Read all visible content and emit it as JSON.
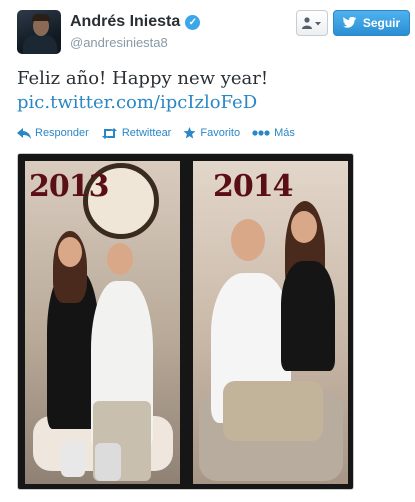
{
  "user": {
    "display_name": "Andrés Iniesta",
    "screen_name": "@andresiniesta8",
    "verified": true
  },
  "buttons": {
    "follow_label": "Seguir",
    "follow_menu_icon": "user-dropdown-icon"
  },
  "tweet": {
    "text": "Feliz año! Happy new year!",
    "link": "pic.twitter.com/ipcIzloFeD"
  },
  "actions": [
    {
      "label": "Responder",
      "icon": "reply-icon"
    },
    {
      "label": "Retwittear",
      "icon": "retweet-icon"
    },
    {
      "label": "Favorito",
      "icon": "star-icon"
    },
    {
      "label": "Más",
      "icon": "more-icon"
    }
  ],
  "photo": {
    "left_year": "2013",
    "right_year": "2014"
  },
  "colors": {
    "link": "#2a87c6",
    "follow_button": "#3ba0e5",
    "verified": "#3ba6e8",
    "year_text": "#5a0e16"
  }
}
